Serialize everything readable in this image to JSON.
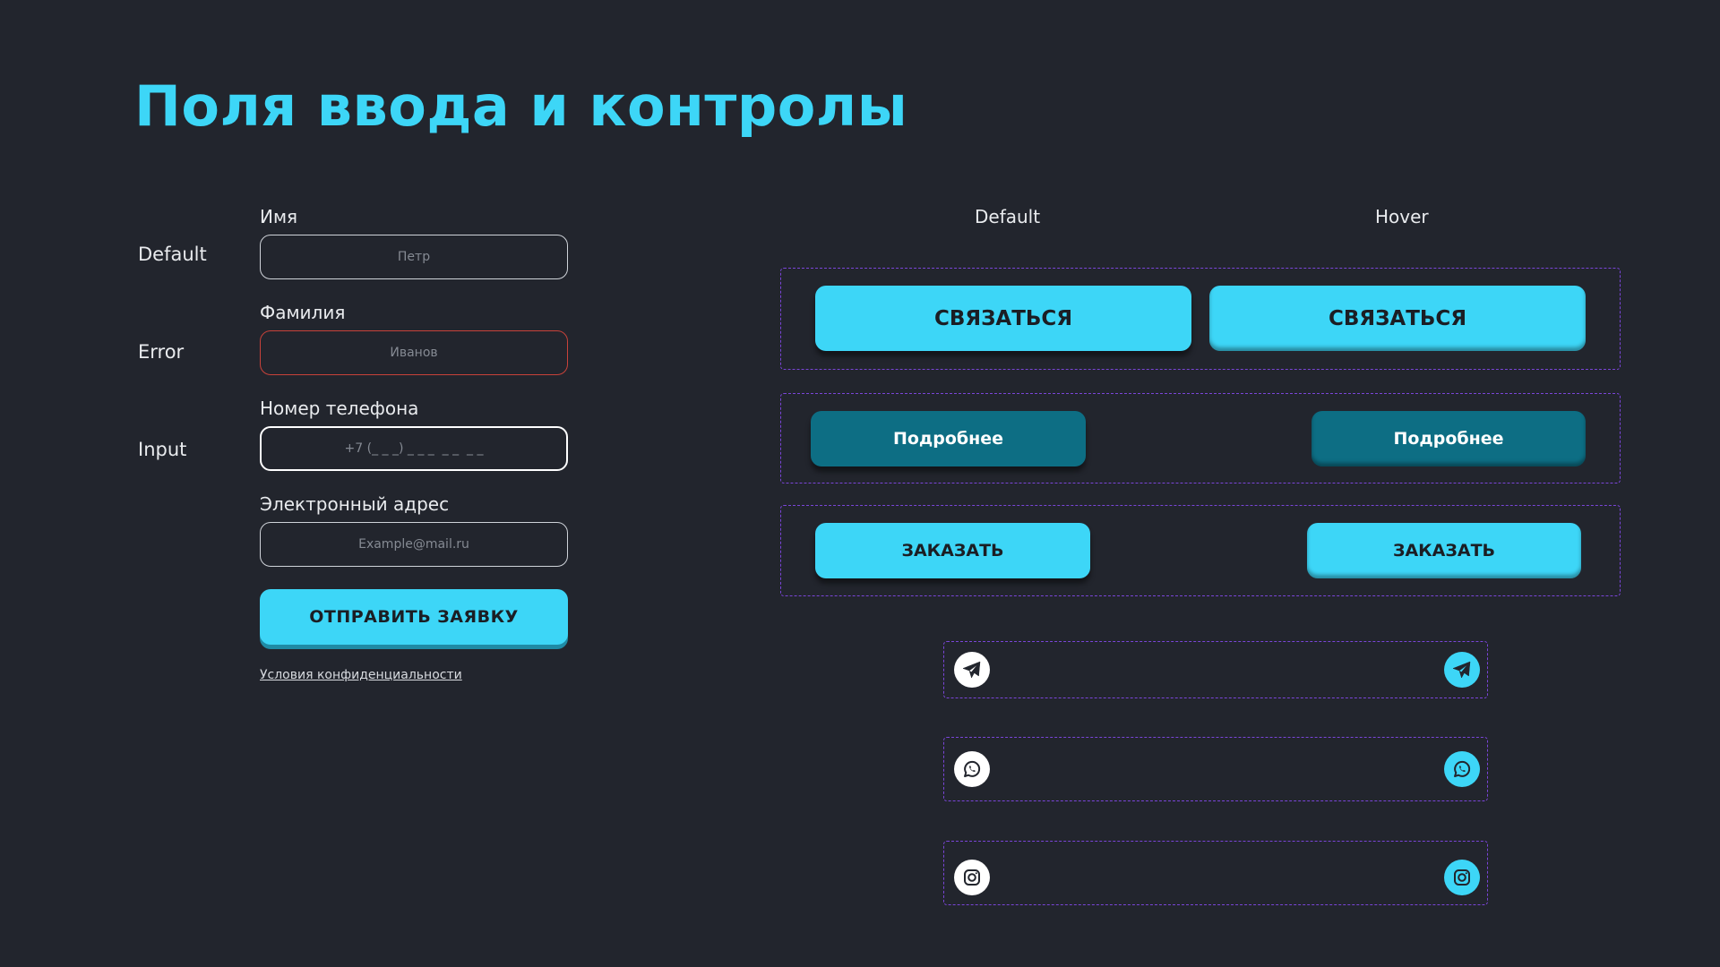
{
  "page": {
    "title": "Поля ввода и контролы"
  },
  "form": {
    "states": {
      "default": "Default",
      "error": "Error",
      "input": "Input"
    },
    "fields": [
      {
        "label": "Имя",
        "placeholder": "Петр"
      },
      {
        "label": "Фамилия",
        "placeholder": "Иванов"
      },
      {
        "label": "Номер телефона",
        "placeholder": "+7 (_ _ _) _ _ _  _ _  _ _"
      },
      {
        "label": "Электронный адрес",
        "placeholder": "Example@mail.ru"
      }
    ],
    "submit_label": "ОТПРАВИТЬ ЗАЯВКУ",
    "privacy_link": "Условия конфиденциальности"
  },
  "buttons": {
    "col_default": "Default",
    "col_hover": "Hover",
    "contact_label": "СВЯЗАТЬСЯ",
    "more_label": "Подробнее",
    "order_label": "ЗАКАЗАТЬ"
  },
  "social_icons": [
    "telegram-icon",
    "whatsapp-icon",
    "instagram-icon"
  ],
  "colors": {
    "background": "#22252d",
    "accent": "#3dd6f7",
    "secondary": "#0d6e84",
    "error": "#c8423a",
    "frame": "#7a45d8"
  }
}
